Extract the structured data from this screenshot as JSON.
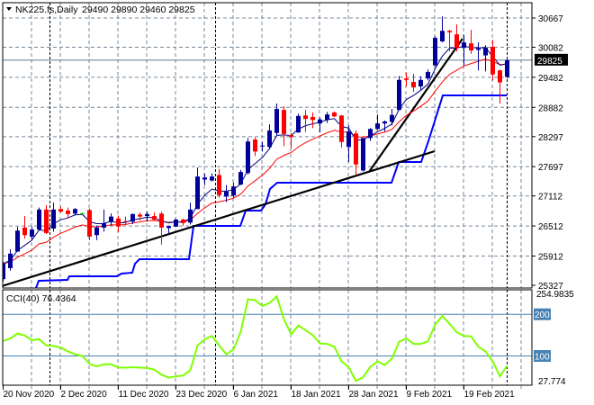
{
  "header": {
    "symbol": "NK225.fs,Daily",
    "ohlc": "29490 29890 29460 29825"
  },
  "colors": {
    "bull": "#000099",
    "bear": "#FF0000",
    "doji": "#00DD00",
    "fast_ma": "#000080",
    "slow_ma": "#FF0000",
    "step_line": "#0000FF",
    "trendline": "#000000",
    "cci": "#7FFF00",
    "level": "#4682B4",
    "grid": "#778899"
  },
  "chart_data": [
    {
      "type": "candlestick",
      "title": "NK225.fs,Daily",
      "ylim": [
        25327,
        30667
      ],
      "y_ticks": [
        "30667",
        "30082",
        "29482",
        "28882",
        "28297",
        "27697",
        "27112",
        "26512",
        "25912",
        "25327"
      ],
      "current_price": "29825",
      "x_labels": [
        {
          "bar": 0,
          "text": "20 Nov 2020"
        },
        {
          "bar": 8,
          "text": "2 Dec 2020"
        },
        {
          "bar": 16,
          "text": "11 Dec 2020"
        },
        {
          "bar": 24,
          "text": "23 Dec 2020"
        },
        {
          "bar": 32,
          "text": "6 Jan 2021"
        },
        {
          "bar": 40,
          "text": "18 Jan 2021"
        },
        {
          "bar": 48,
          "text": "28 Jan 2021"
        },
        {
          "bar": 56,
          "text": "9 Feb 2021"
        },
        {
          "bar": 64,
          "text": "19 Feb 2021"
        }
      ],
      "ohlc": [
        [
          25450,
          25800,
          25400,
          25760
        ],
        [
          25670,
          26046,
          25620,
          25960
        ],
        [
          26000,
          26494,
          26000,
          26420
        ],
        [
          26480,
          26711,
          26260,
          26330
        ],
        [
          26300,
          26500,
          26250,
          26440
        ],
        [
          26440,
          26880,
          26420,
          26840
        ],
        [
          26840,
          26930,
          26350,
          26370
        ],
        [
          26460,
          26980,
          26400,
          26840
        ],
        [
          26850,
          26900,
          26780,
          26800
        ],
        [
          26820,
          26880,
          26660,
          26750
        ],
        [
          26760,
          26870,
          26730,
          26850
        ],
        [
          26770,
          26780,
          26760,
          26770
        ],
        [
          26830,
          26860,
          26230,
          26300
        ],
        [
          26330,
          26520,
          26230,
          26480
        ],
        [
          26480,
          26840,
          26400,
          26570
        ],
        [
          26590,
          26760,
          26520,
          26700
        ],
        [
          26660,
          26720,
          26390,
          26500
        ],
        [
          26610,
          26700,
          26530,
          26600
        ],
        [
          26600,
          26760,
          26550,
          26750
        ],
        [
          26740,
          26780,
          26620,
          26700
        ],
        [
          26710,
          26800,
          26600,
          26750
        ],
        [
          26710,
          26780,
          26620,
          26640
        ],
        [
          26760,
          26800,
          26140,
          26480
        ],
        [
          26470,
          26520,
          26340,
          26510
        ],
        [
          26500,
          26660,
          26490,
          26640
        ],
        [
          26640,
          26660,
          26520,
          26570
        ],
        [
          26580,
          26980,
          26540,
          26840
        ],
        [
          26850,
          27680,
          26850,
          27500
        ],
        [
          27440,
          27560,
          27330,
          27480
        ],
        [
          27420,
          27560,
          27400,
          27500
        ],
        [
          27530,
          27650,
          27080,
          27130
        ],
        [
          27100,
          27330,
          26990,
          27200
        ],
        [
          27120,
          27380,
          27080,
          27300
        ],
        [
          27340,
          27630,
          27330,
          27590
        ],
        [
          27570,
          28270,
          27540,
          28200
        ],
        [
          28240,
          28280,
          27910,
          28000
        ],
        [
          28100,
          28190,
          28000,
          28120
        ],
        [
          28090,
          28540,
          28060,
          28420
        ],
        [
          28370,
          28960,
          28330,
          28850
        ],
        [
          28830,
          28900,
          28110,
          28350
        ],
        [
          28330,
          28370,
          28060,
          28290
        ],
        [
          28380,
          28760,
          28380,
          28710
        ],
        [
          28720,
          28830,
          28390,
          28650
        ],
        [
          28690,
          28780,
          28470,
          28630
        ],
        [
          28560,
          28680,
          28380,
          28640
        ],
        [
          28630,
          28790,
          28570,
          28740
        ],
        [
          28780,
          28800,
          28690,
          28700
        ],
        [
          28720,
          28730,
          28080,
          28190
        ],
        [
          28090,
          28520,
          27790,
          28400
        ],
        [
          28360,
          28420,
          27520,
          27740
        ],
        [
          27620,
          28270,
          27600,
          28270
        ],
        [
          28270,
          28470,
          28210,
          28450
        ],
        [
          28450,
          28740,
          28430,
          28560
        ],
        [
          28560,
          28620,
          28400,
          28600
        ],
        [
          28590,
          28850,
          28520,
          28730
        ],
        [
          28830,
          29510,
          28830,
          29430
        ],
        [
          29460,
          29580,
          29300,
          29430
        ],
        [
          29390,
          29550,
          29190,
          29280
        ],
        [
          29300,
          29500,
          29240,
          29430
        ],
        [
          29460,
          29640,
          29420,
          29590
        ],
        [
          29720,
          30300,
          29700,
          30270
        ],
        [
          30200,
          30700,
          30180,
          30410
        ],
        [
          30410,
          30430,
          30000,
          30380
        ],
        [
          30340,
          30540,
          30000,
          30070
        ],
        [
          30070,
          30330,
          29715,
          30180
        ],
        [
          30160,
          30430,
          29950,
          30020
        ],
        [
          30030,
          30180,
          29620,
          30060
        ],
        [
          29920,
          30120,
          29600,
          30080
        ],
        [
          30090,
          30230,
          29420,
          29540
        ],
        [
          29620,
          29640,
          28960,
          29380
        ],
        [
          29490,
          29890,
          29460,
          29825
        ]
      ],
      "step_line": [
        [
          4.56,
          25273
        ],
        [
          4.94,
          25417
        ],
        [
          8.94,
          25435
        ],
        [
          9.19,
          25507
        ],
        [
          15.81,
          25507
        ],
        [
          16.44,
          25561
        ],
        [
          17.94,
          25579
        ],
        [
          18.31,
          25758
        ],
        [
          18.94,
          25848
        ],
        [
          25.81,
          25848
        ],
        [
          26.44,
          26514
        ],
        [
          32.94,
          26514
        ],
        [
          33.69,
          26819
        ],
        [
          35.81,
          26819
        ],
        [
          36.44,
          26945
        ],
        [
          37.06,
          27251
        ],
        [
          38.06,
          27377
        ],
        [
          53.94,
          27377
        ],
        [
          54.94,
          27790
        ],
        [
          58.06,
          27790
        ],
        [
          59.06,
          28204
        ],
        [
          61.06,
          29121
        ],
        [
          69.94,
          29121
        ]
      ],
      "trendlines": [
        [
          [
            -0.2,
            25309
          ],
          [
            59.94,
            28006
          ]
        ],
        [
          [
            50.9,
            27610
          ],
          [
            63.8,
            30253
          ]
        ]
      ],
      "period_separators_bars": [
        7,
        30,
        70
      ]
    },
    {
      "type": "line",
      "title": "CCI(40) 76.4364",
      "ylim": [
        27.774,
        254.9835
      ],
      "y_ticks": {
        "max": "254.9835",
        "min": "27.774"
      },
      "levels": [
        "200",
        "100"
      ],
      "values": [
        136,
        142,
        154,
        149,
        138,
        140,
        125,
        124,
        120,
        111,
        104,
        100,
        81,
        75,
        80,
        80,
        72,
        72,
        73,
        72,
        71,
        67,
        55,
        48,
        51,
        53,
        66,
        125,
        140,
        148,
        125,
        104,
        116,
        158,
        236,
        234,
        220,
        227,
        243,
        188,
        152,
        173,
        162,
        150,
        130,
        129,
        122,
        87,
        73,
        40,
        49,
        74,
        87,
        78,
        94,
        134,
        142,
        129,
        129,
        135,
        175,
        196,
        177,
        157,
        148,
        147,
        122,
        111,
        87,
        51,
        76.4364
      ]
    }
  ]
}
